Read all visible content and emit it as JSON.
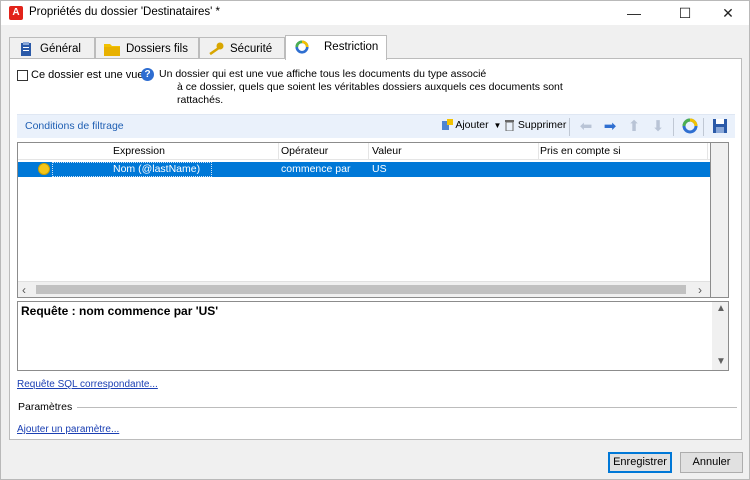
{
  "window": {
    "title": "Propriétés du dossier 'Destinataires' *",
    "controls": {
      "minimize": "—",
      "maximize": "☐",
      "close": "✕"
    }
  },
  "tabs": [
    {
      "label": "Général",
      "icon": "clipboard-icon",
      "active": false
    },
    {
      "label": "Dossiers fils",
      "icon": "folder-icon",
      "active": false
    },
    {
      "label": "Sécurité",
      "icon": "key-icon",
      "active": false
    },
    {
      "label": "Restriction",
      "icon": "restriction-icon",
      "active": true
    }
  ],
  "view_option": {
    "checkbox_label": "Ce dossier est une vue",
    "checked": false,
    "info_line1": "Un dossier qui est une vue affiche tous les documents du type associé",
    "info_line2": "à ce dossier, quels que soient les véritables dossiers auxquels ces documents sont rattachés."
  },
  "filter": {
    "title": "Conditions de filtrage",
    "toolbar": {
      "add_label": "Ajouter",
      "delete_label": "Supprimer",
      "icons": [
        "arrow-left-icon",
        "arrow-right-icon",
        "arrow-up-icon",
        "arrow-down-icon",
        "restriction-icon",
        "save-icon"
      ]
    },
    "columns": [
      "Expression",
      "Opérateur",
      "Valeur",
      "Pris en compte si"
    ],
    "rows": [
      {
        "expression": "Nom (@lastName)",
        "operator": "commence par",
        "value": "US",
        "condition": ""
      }
    ]
  },
  "query": {
    "text": "Requête : nom commence par 'US'"
  },
  "links": {
    "sql": "Requête SQL correspondante...",
    "add_param": "Ajouter un paramètre..."
  },
  "params_label": "Paramètres",
  "buttons": {
    "save": "Enregistrer",
    "cancel": "Annuler"
  },
  "colors": {
    "selection": "#0078d7",
    "link": "#1a3fb3",
    "filter_bar": "#eaf1fb",
    "accent_red": "#e2231a"
  }
}
